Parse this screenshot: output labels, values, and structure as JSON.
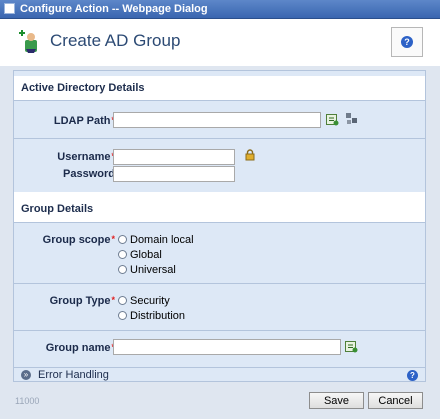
{
  "window": {
    "title": "Configure Action -- Webpage Dialog",
    "heading": "Create AD Group",
    "help_icon": "help-icon",
    "accent_color": "#2c4a74"
  },
  "sections": {
    "active_directory": "Active Directory Details",
    "group": "Group Details"
  },
  "fields": {
    "ldap_path": {
      "label": "LDAP Path",
      "required": "*",
      "value": ""
    },
    "username": {
      "label": "Username",
      "required": "*",
      "value": ""
    },
    "password": {
      "label": "Password",
      "value": ""
    },
    "group_scope": {
      "label": "Group scope",
      "required": "*",
      "options": [
        "Domain local",
        "Global",
        "Universal"
      ],
      "selected": null
    },
    "group_type": {
      "label": "Group Type",
      "required": "*",
      "options": [
        "Security",
        "Distribution"
      ],
      "selected": null
    },
    "group_name": {
      "label": "Group name",
      "required": "*",
      "value": ""
    }
  },
  "error_handling": {
    "label": "Error Handling"
  },
  "footer": {
    "code": "11000",
    "save": "Save",
    "cancel": "Cancel"
  }
}
